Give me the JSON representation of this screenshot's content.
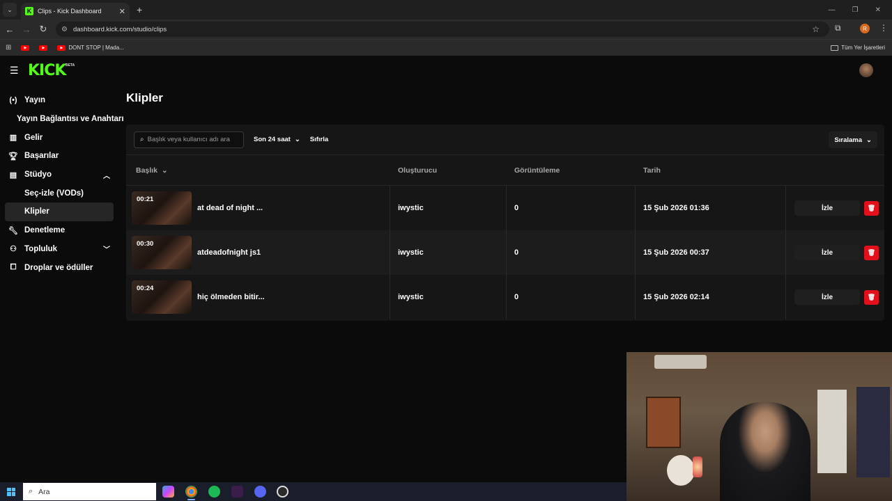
{
  "browser": {
    "tab_title": "Clips - Kick Dashboard",
    "tab_favicon_letter": "K",
    "url": "dashboard.kick.com/studio/clips",
    "bookmarks": [
      {
        "label": "",
        "icon": "youtube-icon"
      },
      {
        "label": "",
        "icon": "youtube-icon"
      },
      {
        "label": "DONT STOP | Mada...",
        "icon": "youtube-icon"
      }
    ],
    "bookmarks_folder": "Tüm Yer İşaretleri",
    "profile_initial": "R"
  },
  "header": {
    "logo": "KICK",
    "logo_badge": "BETA",
    "brand_color": "#53fc18"
  },
  "sidebar": {
    "items": [
      {
        "label": "Yayın",
        "icon": "broadcast-icon"
      },
      {
        "label": "Yayın Bağlantısı ve Anahtarı",
        "icon": ""
      },
      {
        "label": "Gelir",
        "icon": "chart-icon"
      },
      {
        "label": "Başarılar",
        "icon": "trophy-icon"
      },
      {
        "label": "Stüdyo",
        "icon": "studio-icon"
      },
      {
        "label": "Seç-izle (VODs)",
        "icon": ""
      },
      {
        "label": "Klipler",
        "icon": ""
      },
      {
        "label": "Denetleme",
        "icon": "wrench-icon"
      },
      {
        "label": "Topluluk",
        "icon": "community-icon"
      },
      {
        "label": "Droplar ve ödüller",
        "icon": "drops-icon"
      }
    ]
  },
  "main": {
    "title": "Klipler",
    "search_placeholder": "Başlık veya kullanıcı adı ara",
    "time_filter": "Son 24 saat",
    "reset_label": "Sıfırla",
    "sort_label": "Sıralama",
    "columns": {
      "title": "Başlık",
      "creator": "Oluşturucu",
      "views": "Görüntüleme",
      "date": "Tarih"
    },
    "watch_label": "İzle",
    "danger_color": "#e3101b",
    "clips": [
      {
        "duration": "00:21",
        "title": "at dead of night ...",
        "creator": "iwystic",
        "views": "0",
        "date": "15 Şub 2026 01:36"
      },
      {
        "duration": "00:30",
        "title": "atdeadofnight js1",
        "creator": "iwystic",
        "views": "0",
        "date": "15 Şub 2026 00:37"
      },
      {
        "duration": "00:24",
        "title": "hiç ölmeden bitir...",
        "creator": "iwystic",
        "views": "0",
        "date": "15 Şub 2026 02:14"
      }
    ]
  },
  "taskbar": {
    "search_placeholder": "Ara"
  }
}
